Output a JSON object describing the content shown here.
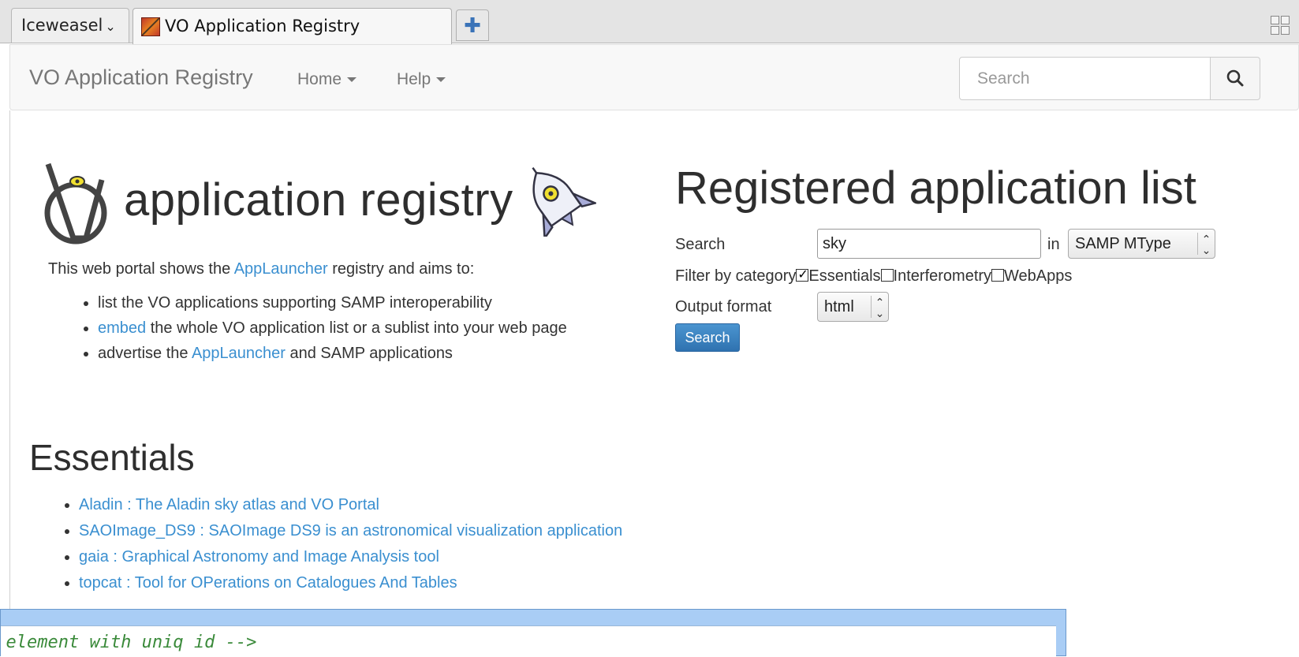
{
  "browser": {
    "menu_label": "Iceweasel",
    "tab_title": "VO Application Registry",
    "new_tab_symbol": "✚"
  },
  "navbar": {
    "brand": "VO Application Registry",
    "home_label": "Home",
    "help_label": "Help",
    "search_placeholder": "Search"
  },
  "logo": {
    "text": "application registry"
  },
  "intro": {
    "prefix": "This web portal shows the ",
    "link": "AppLauncher",
    "suffix": " registry and aims to:",
    "bullets": [
      {
        "text": "list the VO applications supporting SAMP interoperability"
      },
      {
        "link": "embed",
        "text": " the whole VO application list or a sublist into your web page"
      },
      {
        "prefix": "advertise the ",
        "link": "AppLauncher",
        "text": " and SAMP applications"
      }
    ]
  },
  "search_form": {
    "title": "Registered application list",
    "search_label": "Search",
    "search_value": "sky",
    "in_label": "in",
    "field_select": "SAMP MType",
    "filter_label": "Filter by category",
    "categories": [
      {
        "label": "Essentials",
        "checked": true
      },
      {
        "label": "Interferometry",
        "checked": false
      },
      {
        "label": "WebApps",
        "checked": false
      }
    ],
    "output_label": "Output format",
    "output_select": "html",
    "submit_label": "Search"
  },
  "essentials": {
    "title": "Essentials",
    "items": [
      "Aladin : The Aladin sky atlas and VO Portal",
      "SAOImage_DS9 : SAOImage DS9 is an astronomical visualization application",
      "gaia : Graphical Astronomy and Image Analysis tool",
      "topcat : Tool for OPerations on Catalogues And Tables"
    ]
  },
  "bottom_panel": {
    "code_text": "l element with uniq id -->"
  },
  "colors": {
    "link": "#3a8fd0",
    "primary_button": "#337ab7",
    "navbar_bg": "#f8f8f8",
    "panel_blue": "#a9cdf5",
    "comment_green": "#3a8a3a"
  },
  "icons": {
    "search": "magnifier-icon",
    "tab_groups": "tab-groups-icon",
    "logo_v": "vo-logo-icon",
    "rocket": "rocket-icon"
  }
}
